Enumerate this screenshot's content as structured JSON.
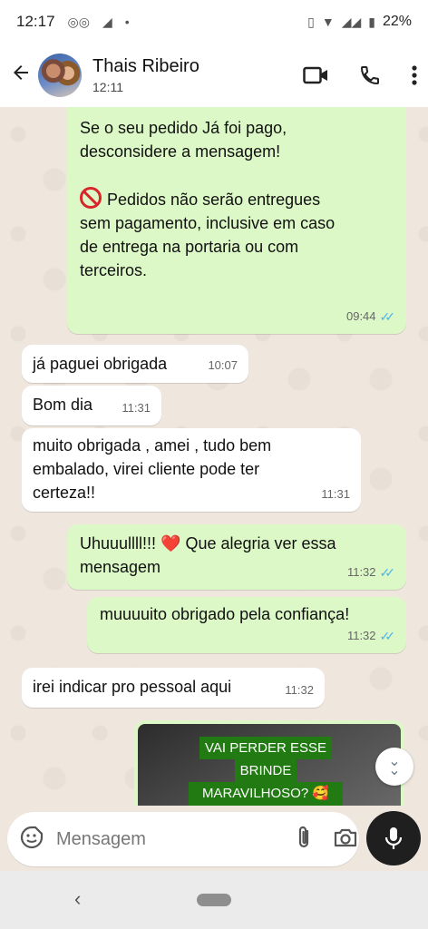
{
  "status": {
    "time": "12:17",
    "battery": "22%"
  },
  "header": {
    "name": "Thais Ribeiro",
    "last_seen": "12:11"
  },
  "messages": [
    {
      "dir": "out",
      "lines": [
        "Se o seu pedido Já foi pago,",
        "desconsidere a mensagem!"
      ],
      "lines2": [
        "Pedidos não serão entregues",
        "sem pagamento, inclusive em caso",
        "de entrega na portaria ou com",
        "terceiros."
      ],
      "time": "09:44"
    },
    {
      "dir": "in",
      "text": "já paguei obrigada",
      "time": "10:07"
    },
    {
      "dir": "in",
      "text": "Bom dia",
      "time": "11:31"
    },
    {
      "dir": "in",
      "lines": [
        "muito obrigada , amei , tudo bem",
        "embalado, virei cliente pode ter",
        "certeza!!"
      ],
      "time": "11:31"
    },
    {
      "dir": "out",
      "lines": [
        "Uhuuullll!!! ❤️ Que alegria ver essa",
        "mensagem"
      ],
      "time": "11:32"
    },
    {
      "dir": "out",
      "text": "muuuuito obrigado pela confiança!",
      "time": "11:32"
    },
    {
      "dir": "in",
      "text": "irei indicar pro pessoal aqui",
      "time": "11:32"
    }
  ],
  "image_caption": {
    "lines": [
      "VAI PERDER ESSE",
      "BRINDE",
      "MARAVILHOSO? 🥰😊"
    ]
  },
  "composer": {
    "placeholder": "Mensagem"
  },
  "colors": {
    "out_bubble": "#dcf8c6",
    "in_bubble": "#ffffff",
    "read_ticks": "#4fb6ec",
    "mic_button": "#1f1f1f"
  },
  "icons": [
    "back-arrow-icon",
    "video-call-icon",
    "phone-icon",
    "more-vert-icon",
    "sticker-icon",
    "attach-icon",
    "camera-icon",
    "mic-icon",
    "chevron-down-icon"
  ]
}
